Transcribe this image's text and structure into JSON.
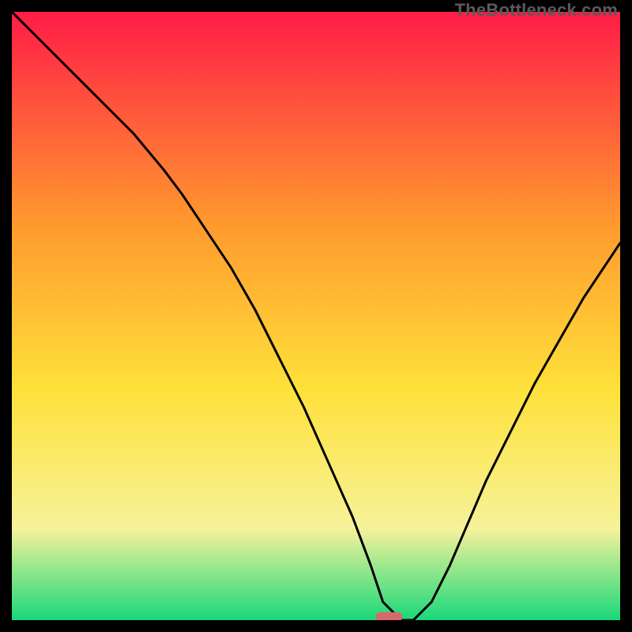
{
  "watermark": "TheBottleneck.com",
  "chart_data": {
    "type": "line",
    "title": "",
    "xlabel": "",
    "ylabel": "",
    "xlim": [
      0,
      100
    ],
    "ylim": [
      0,
      100
    ],
    "grid": false,
    "legend": false,
    "background_gradient_top": "#ff1c47",
    "background_gradient_mid1": "#ff9a2e",
    "background_gradient_mid2": "#ffe13a",
    "background_gradient_mid3": "#f6f29a",
    "background_gradient_bottom": "#1ad87a",
    "marker": {
      "x": 62,
      "y": 0,
      "color": "#d46a6a",
      "shape": "rounded-rect"
    },
    "series": [
      {
        "name": "curve",
        "color": "#000000",
        "x": [
          0,
          5,
          10,
          15,
          20,
          25,
          28,
          32,
          36,
          40,
          44,
          48,
          52,
          56,
          59,
          61,
          64,
          66,
          69,
          72,
          75,
          78,
          82,
          86,
          90,
          94,
          98,
          100
        ],
        "values": [
          100,
          95,
          90,
          85,
          80,
          74,
          70,
          64,
          58,
          51,
          43,
          35,
          26,
          17,
          9,
          3,
          0,
          0,
          3,
          9,
          16,
          23,
          31,
          39,
          46,
          53,
          59,
          62
        ]
      }
    ]
  }
}
